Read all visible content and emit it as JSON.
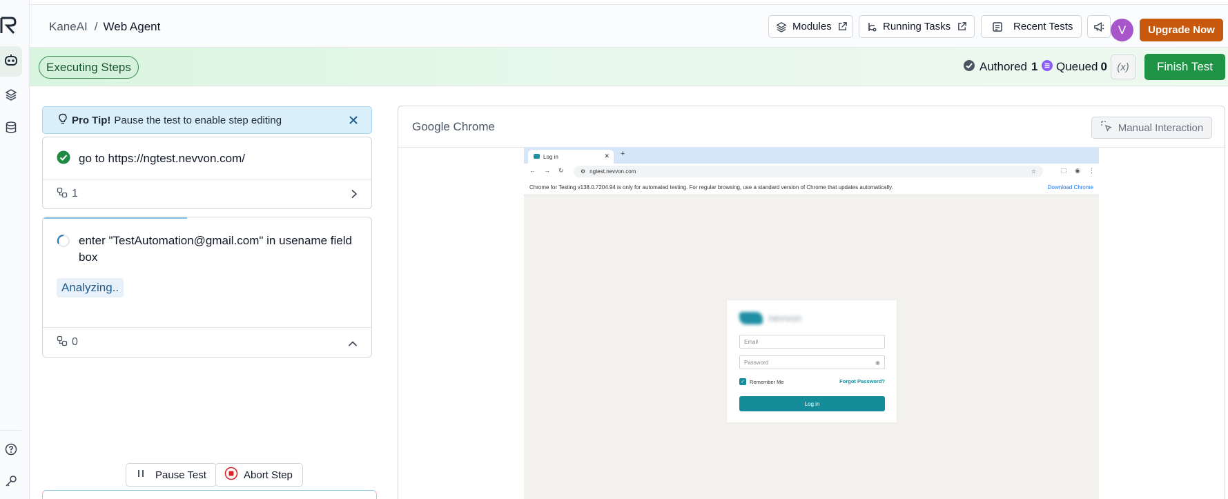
{
  "header": {
    "breadcrumb_root": "KaneAI",
    "breadcrumb_sep": "/",
    "breadcrumb_current": "Web Agent",
    "modules_label": "Modules",
    "running_tasks_label": "Running Tasks",
    "recent_tests_label": "Recent Tests",
    "avatar_letter": "V",
    "upgrade_label": "Upgrade Now"
  },
  "status": {
    "executing_label": "Executing Steps",
    "authored_label": "Authored",
    "authored_count": "1",
    "queued_label": "Queued",
    "queued_count": "0",
    "variables_label": "(x)",
    "finish_label": "Finish Test"
  },
  "tip": {
    "title": "Pro Tip!",
    "text": "Pause the test to enable step editing"
  },
  "steps": [
    {
      "text": "go to https://ngtest.nevvon.com/",
      "status": "done",
      "sub_count": "1"
    },
    {
      "text": "enter \"TestAutomation@gmail.com\" in usename field box",
      "status": "running",
      "analyzing_label": "Analyzing..",
      "sub_count": "0"
    }
  ],
  "controls": {
    "pause_label": "Pause Test",
    "abort_label": "Abort Step"
  },
  "browser": {
    "title": "Google Chrome",
    "manual_label": "Manual Interaction",
    "tab_title": "Log in",
    "url": "ngtest.nevvon.com",
    "infobar_text": "Chrome for Testing v138.0.7204.94 is only for automated testing. For regular browsing, use a standard version of Chrome that updates automatically.",
    "infobar_link": "Download Chrome",
    "login": {
      "email_placeholder": "Email",
      "password_placeholder": "Password",
      "remember_label": "Remember Me",
      "forgot_label": "Forgot Password?",
      "login_button": "Log in"
    }
  },
  "colors": {
    "upgrade": "#c9580f",
    "finish": "#1f9445",
    "executing_border": "#2f8a4e",
    "brand_teal": "#148c99",
    "queued_icon": "#8b5cf6"
  }
}
